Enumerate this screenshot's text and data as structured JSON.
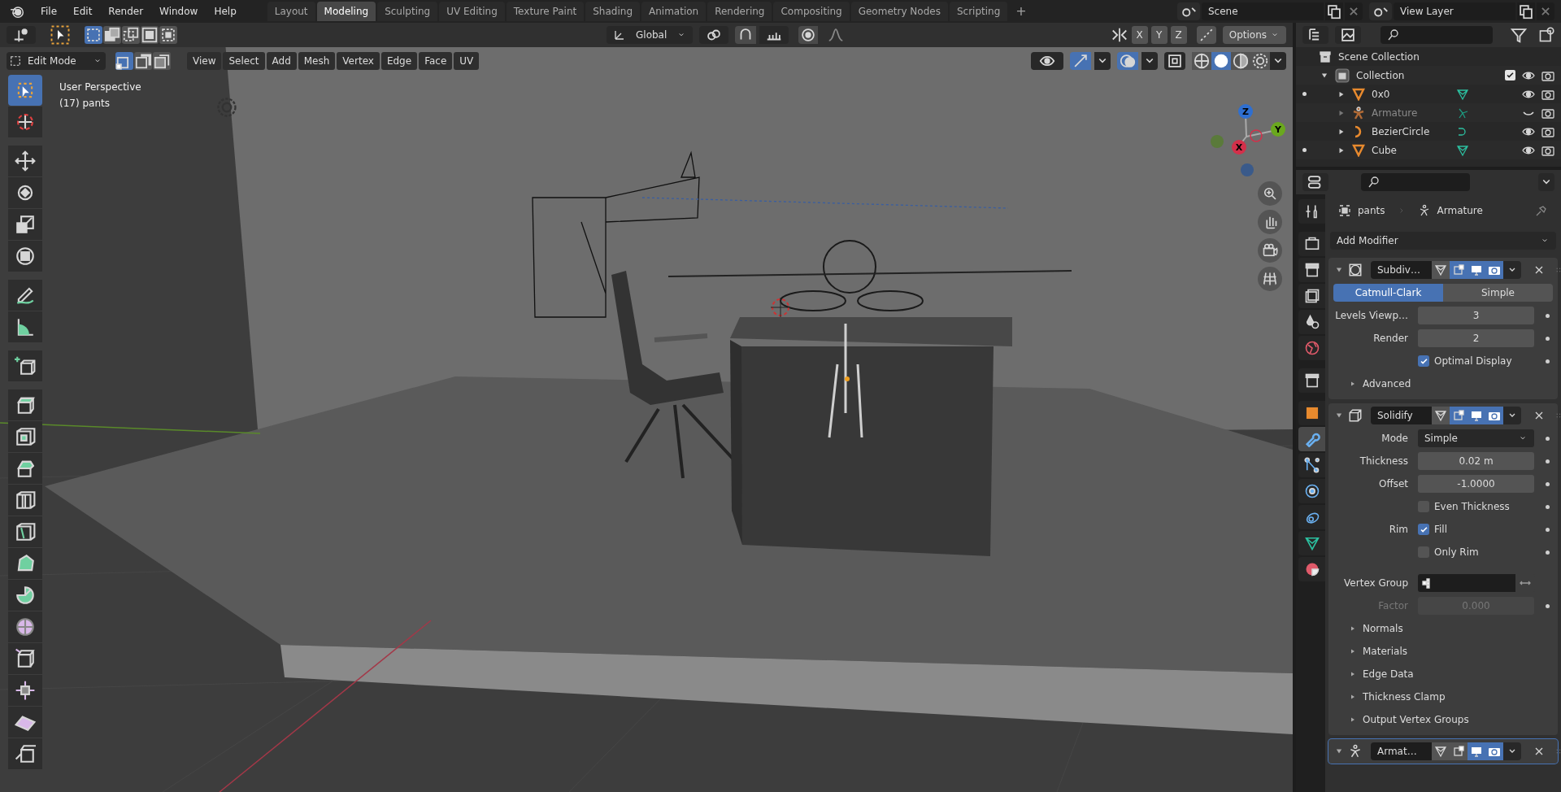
{
  "top_bar": {
    "menus": [
      "File",
      "Edit",
      "Render",
      "Window",
      "Help"
    ],
    "workspaces": [
      {
        "label": "Layout",
        "selected": false
      },
      {
        "label": "Modeling",
        "selected": true
      },
      {
        "label": "Sculpting",
        "selected": false
      },
      {
        "label": "UV Editing",
        "selected": false
      },
      {
        "label": "Texture Paint",
        "selected": false
      },
      {
        "label": "Shading",
        "selected": false
      },
      {
        "label": "Animation",
        "selected": false
      },
      {
        "label": "Rendering",
        "selected": false
      },
      {
        "label": "Compositing",
        "selected": false
      },
      {
        "label": "Geometry Nodes",
        "selected": false
      },
      {
        "label": "Scripting",
        "selected": false
      }
    ],
    "add_workspace": "+",
    "scene": "Scene",
    "view_layer": "View Layer"
  },
  "tool_settings": {
    "orientation": "Global",
    "axes": [
      "X",
      "Y",
      "Z"
    ],
    "options": "Options"
  },
  "header": {
    "mode": "Edit Mode",
    "select_modes": [
      {
        "selected": true
      },
      {
        "selected": false
      },
      {
        "selected": false
      }
    ],
    "menus": [
      "View",
      "Select",
      "Add",
      "Mesh",
      "Vertex",
      "Edge",
      "Face",
      "UV"
    ],
    "shading_modes": [
      {
        "selected": false
      },
      {
        "selected": true
      },
      {
        "selected": false
      },
      {
        "selected": false
      }
    ]
  },
  "viewport": {
    "overlay_text": [
      "User Perspective",
      "(17) pants"
    ],
    "gizmo_axes": [
      "Z",
      "Y",
      "X"
    ]
  },
  "tools": [
    {
      "selected": true
    },
    {
      "selected": false
    },
    {
      "selected": false
    },
    {
      "selected": false
    },
    {
      "selected": false
    },
    {
      "selected": false
    },
    {
      "selected": false
    },
    {
      "selected": false
    },
    {
      "selected": false
    },
    {
      "selected": false
    },
    {
      "selected": false
    },
    {
      "selected": false
    },
    {
      "selected": false
    },
    {
      "selected": false
    },
    {
      "selected": false
    },
    {
      "selected": false
    },
    {
      "selected": false
    },
    {
      "selected": false
    },
    {
      "selected": false
    },
    {
      "selected": false
    },
    {
      "selected": false
    }
  ],
  "outliner": {
    "root": "Scene Collection",
    "collection": {
      "label": "Collection",
      "checked": true,
      "children": [
        {
          "name": "0x0",
          "kind": "mesh",
          "hidden": false,
          "dot": true
        },
        {
          "name": "Armature",
          "kind": "armature",
          "hidden": true,
          "dot": false
        },
        {
          "name": "BezierCircle",
          "kind": "curve",
          "hidden": false,
          "dot": false
        },
        {
          "name": "Cube",
          "kind": "mesh",
          "hidden": false,
          "dot": true
        }
      ]
    }
  },
  "properties": {
    "tabs": [
      {
        "selected": false
      },
      {
        "selected": false
      },
      {
        "selected": false
      },
      {
        "selected": false
      },
      {
        "selected": false
      },
      {
        "selected": false
      },
      {
        "selected": false
      },
      {
        "selected": false
      },
      {
        "selected": true
      },
      {
        "selected": false
      },
      {
        "selected": false
      },
      {
        "selected": false
      },
      {
        "selected": false
      },
      {
        "selected": false
      }
    ],
    "breadcrumb": [
      "pants",
      "Armature"
    ],
    "add_modifier": "Add Modifier",
    "modifiers": [
      {
        "name": "Subdiv…",
        "kind": "subsurf",
        "active": false,
        "toggles": [
          {
            "on": false
          },
          {
            "on": true
          },
          {
            "on": true
          },
          {
            "on": true
          }
        ],
        "rows": [
          {
            "kind": "segmented",
            "options": [
              {
                "label": "Catmull-Clark",
                "selected": true
              },
              {
                "label": "Simple",
                "selected": false
              }
            ]
          },
          {
            "kind": "number",
            "label": "Levels Viewp…",
            "value": "3",
            "disabled": false
          },
          {
            "kind": "number",
            "label": "Render",
            "value": "2",
            "disabled": false
          },
          {
            "kind": "checkbox",
            "text": "Optimal Display",
            "checked": true
          },
          {
            "kind": "subpanel",
            "text": "Advanced"
          }
        ]
      },
      {
        "name": "Solidify",
        "kind": "solidify",
        "active": false,
        "toggles": [
          {
            "on": false
          },
          {
            "on": true
          },
          {
            "on": true
          },
          {
            "on": true
          }
        ],
        "rows": [
          {
            "kind": "dropdown",
            "label": "Mode",
            "value": "Simple"
          },
          {
            "kind": "number",
            "label": "Thickness",
            "value": "0.02 m",
            "disabled": false
          },
          {
            "kind": "number",
            "label": "Offset",
            "value": "-1.0000",
            "disabled": false
          },
          {
            "kind": "checkbox",
            "text": "Even Thickness",
            "checked": false
          },
          {
            "kind": "checkbox",
            "label": "Rim",
            "text": "Fill",
            "checked": true
          },
          {
            "kind": "checkbox",
            "text": "Only Rim",
            "checked": false
          },
          {
            "kind": "field",
            "label": "Vertex Group"
          },
          {
            "kind": "number",
            "label": "Factor",
            "value": "0.000",
            "disabled": true
          },
          {
            "kind": "subpanel",
            "text": "Normals"
          },
          {
            "kind": "subpanel",
            "text": "Materials"
          },
          {
            "kind": "subpanel",
            "text": "Edge Data"
          },
          {
            "kind": "subpanel",
            "text": "Thickness Clamp"
          },
          {
            "kind": "subpanel",
            "text": "Output Vertex Groups"
          }
        ]
      },
      {
        "name": "Armat…",
        "kind": "armature",
        "active": true,
        "toggles": [
          {
            "on": false
          },
          {
            "on": false
          },
          {
            "on": true
          },
          {
            "on": true
          }
        ]
      }
    ]
  }
}
